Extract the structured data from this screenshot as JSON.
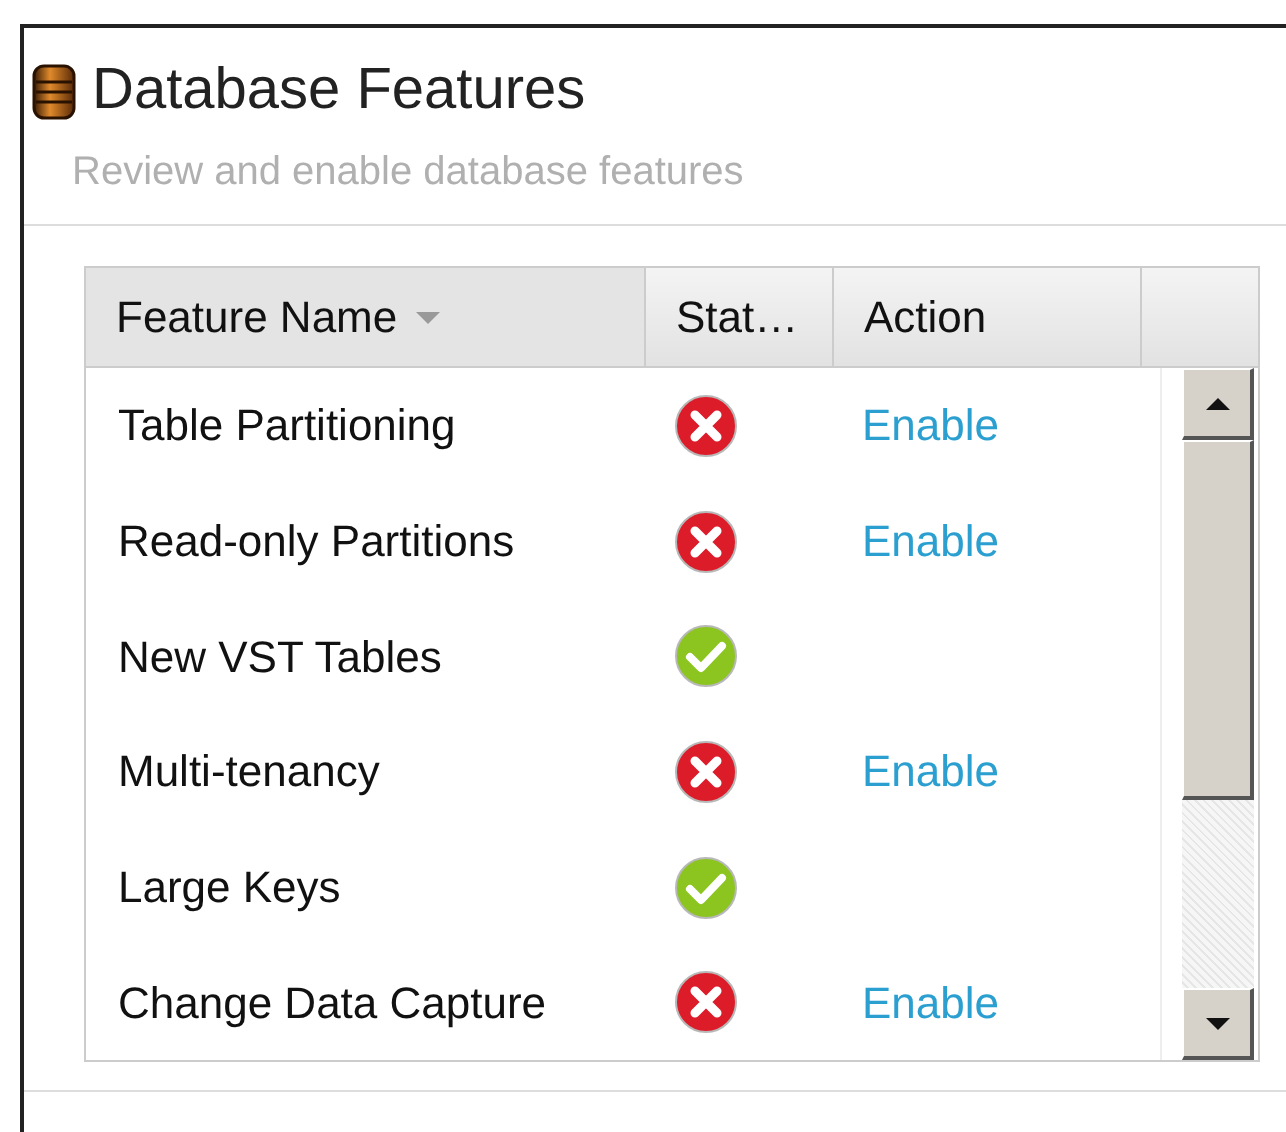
{
  "window": {
    "title": "Database Features",
    "subtitle": "Review and enable database features"
  },
  "table": {
    "columns": [
      {
        "label": "Feature Name",
        "sorted": true
      },
      {
        "label": "Stat…",
        "sorted": false
      },
      {
        "label": "Action",
        "sorted": false
      }
    ],
    "rows": [
      {
        "name": "Table Partitioning",
        "enabled": false,
        "action": "Enable"
      },
      {
        "name": "Read-only Partitions",
        "enabled": false,
        "action": "Enable"
      },
      {
        "name": "New VST Tables",
        "enabled": true
      },
      {
        "name": "Multi-tenancy",
        "enabled": false,
        "action": "Enable"
      },
      {
        "name": "Large Keys",
        "enabled": true
      },
      {
        "name": "Change Data Capture",
        "enabled": false,
        "action": "Enable"
      }
    ]
  }
}
